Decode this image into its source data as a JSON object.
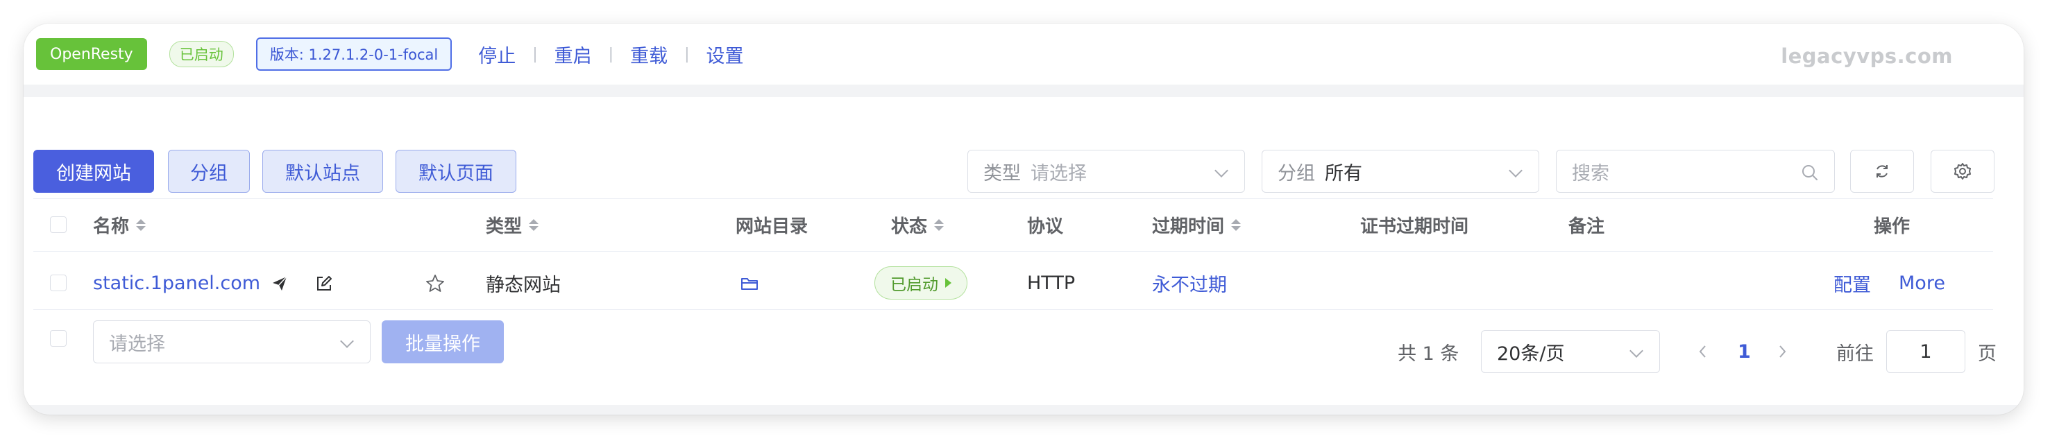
{
  "watermark": "legacyvps.com",
  "header": {
    "app_name": "OpenResty",
    "status": "已启动",
    "version": "版本: 1.27.1.2-0-1-focal",
    "actions": [
      "停止",
      "重启",
      "重载",
      "设置"
    ]
  },
  "toolbar": {
    "create_site": "创建网站",
    "group": "分组",
    "default_site": "默认站点",
    "default_page": "默认页面",
    "type_filter": {
      "label": "类型",
      "placeholder": "请选择"
    },
    "group_filter": {
      "label": "分组",
      "value": "所有"
    },
    "search_placeholder": "搜索",
    "refresh_icon": "refresh-icon",
    "settings_icon": "gear-icon"
  },
  "table": {
    "columns": [
      "名称",
      "类型",
      "网站目录",
      "状态",
      "协议",
      "过期时间",
      "证书过期时间",
      "备注",
      "操作"
    ],
    "rows": [
      {
        "name": "static.1panel.com",
        "type": "静态网站",
        "status": "已启动",
        "protocol": "HTTP",
        "expire": "永不过期",
        "cert_expire": "",
        "remark": "",
        "actions": [
          "配置",
          "More"
        ]
      }
    ]
  },
  "footer": {
    "batch_select_placeholder": "请选择",
    "batch_button": "批量操作",
    "total": "共 1 条",
    "page_size": "20条/页",
    "current_page": "1",
    "goto_label": "前往",
    "goto_value": "1",
    "page_unit": "页"
  },
  "colors": {
    "accent": "#4a5fde",
    "success": "#67c23a",
    "link": "#3f5bd6"
  }
}
